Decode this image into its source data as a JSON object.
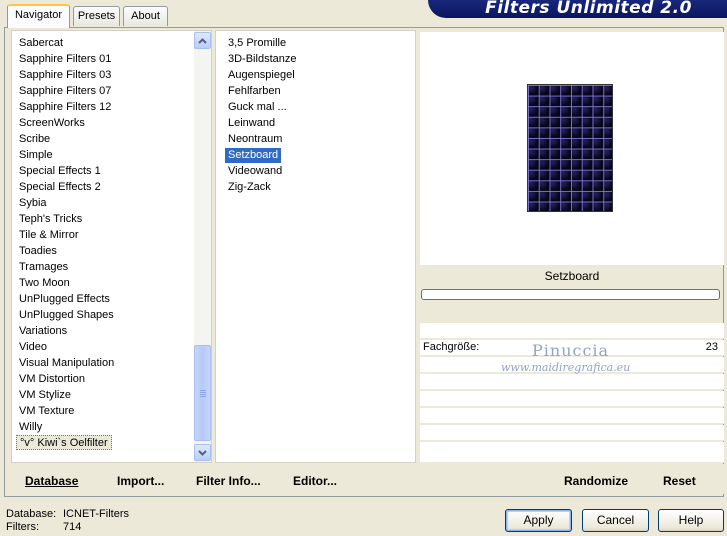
{
  "tabs": [
    {
      "label": "Navigator",
      "active": true
    },
    {
      "label": "Presets",
      "active": false
    },
    {
      "label": "About",
      "active": false
    }
  ],
  "banner": {
    "title": "Filters Unlimited 2.0"
  },
  "categories": [
    "Sabercat",
    "Sapphire Filters 01",
    "Sapphire Filters 03",
    "Sapphire Filters 07",
    "Sapphire Filters 12",
    "ScreenWorks",
    "Scribe",
    "Simple",
    "Special Effects 1",
    "Special Effects 2",
    "Sybia",
    "Teph's Tricks",
    "Tile & Mirror",
    "Toadies",
    "Tramages",
    "Two Moon",
    "UnPlugged Effects",
    "UnPlugged Shapes",
    "Variations",
    "Video",
    "Visual Manipulation",
    "VM Distortion",
    "VM Stylize",
    "VM Texture",
    "Willy",
    "°v° Kiwi`s Oelfilter"
  ],
  "focused_category": "°v° Kiwi`s Oelfilter",
  "filters": [
    "3,5 Promille",
    "3D-Bildstanze",
    "Augenspiegel",
    "Fehlfarben",
    "Guck mal ...",
    "Leinwand",
    "Neontraum",
    "Setzboard",
    "Videowand",
    "Zig-Zack"
  ],
  "selected_filter": "Setzboard",
  "preview": {
    "filter_name": "Setzboard",
    "progress": 0
  },
  "parameters": [
    {
      "label": "Fachgröße:",
      "value": "23"
    }
  ],
  "watermark": {
    "name": "Pinuccia",
    "site": "www.maidiregrafica.eu"
  },
  "toolbar": {
    "database": "Database",
    "import": "Import...",
    "filter_info": "Filter Info...",
    "editor": "Editor...",
    "randomize": "Randomize",
    "reset": "Reset"
  },
  "status": {
    "database_label": "Database:",
    "database_value": "ICNET-Filters",
    "filters_label": "Filters:",
    "filters_value": "714"
  },
  "dialog_buttons": {
    "apply": "Apply",
    "cancel": "Cancel",
    "help": "Help"
  }
}
